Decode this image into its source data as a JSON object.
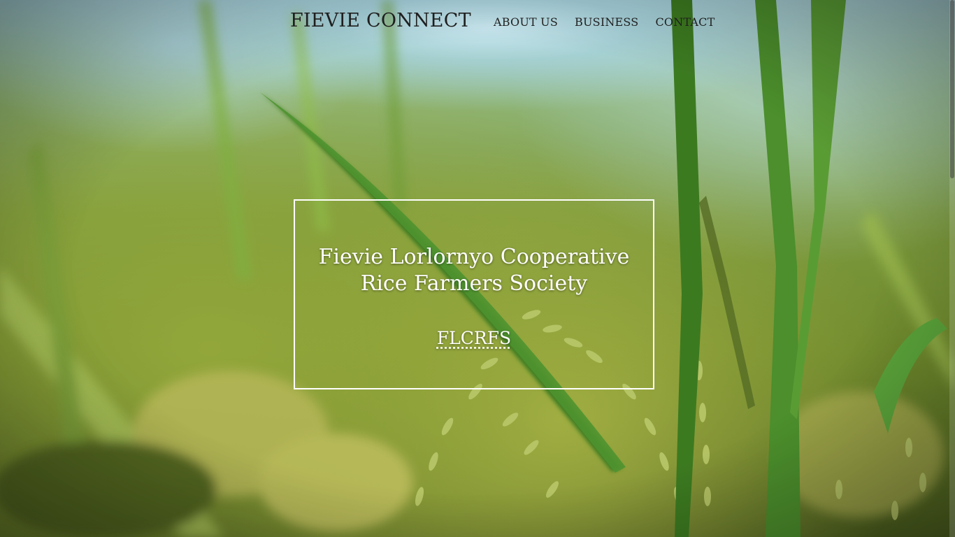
{
  "nav": {
    "brand": "FIEVIE CONNECT",
    "links": [
      {
        "label": "ABOUT US"
      },
      {
        "label": "BUSINESS"
      },
      {
        "label": "CONTACT"
      }
    ]
  },
  "hero": {
    "title_line1": "Fievie Lorlornyo Cooperative",
    "title_line2": "Rice Farmers Society",
    "abbreviation": "FLCRFS"
  },
  "colors": {
    "nav_text": "#1f1f1f",
    "hero_text": "#ffffff",
    "hero_border": "#ffffff"
  },
  "background": {
    "subject": "rice-field-photo"
  }
}
